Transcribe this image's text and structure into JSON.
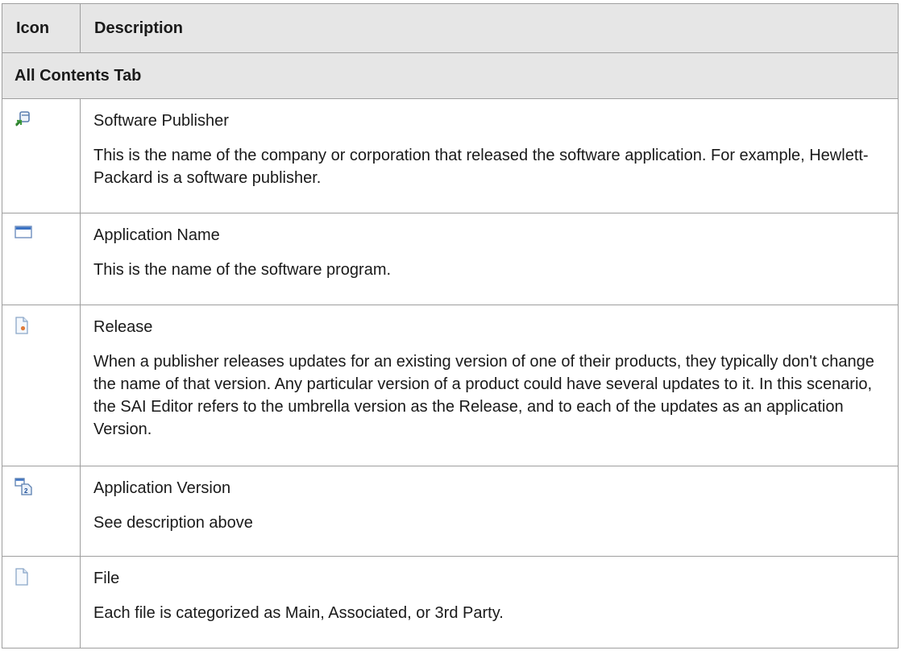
{
  "table": {
    "header": {
      "icon": "Icon",
      "description": "Description"
    },
    "section": "All Contents Tab",
    "rows": [
      {
        "icon": "software-publisher-icon",
        "title": "Software Publisher",
        "text": "This is the name of the company or corporation that released the software application. For example, Hewlett-Packard is a software publisher."
      },
      {
        "icon": "application-name-icon",
        "title": "Application Name",
        "text": "This is the name of the software program."
      },
      {
        "icon": "release-icon",
        "title": "Release",
        "text": "When a publisher releases updates for an existing version of one of their products, they typically don't change the name of that version. Any particular version of a product could have several updates to it. In this scenario, the SAI Editor refers to the umbrella version as the Release, and to each of the updates as an application Version."
      },
      {
        "icon": "application-version-icon",
        "title": "Application Version",
        "text": "See description above"
      },
      {
        "icon": "file-icon",
        "title": "File",
        "text": "Each file is categorized as Main, Associated, or 3rd Party."
      }
    ]
  }
}
